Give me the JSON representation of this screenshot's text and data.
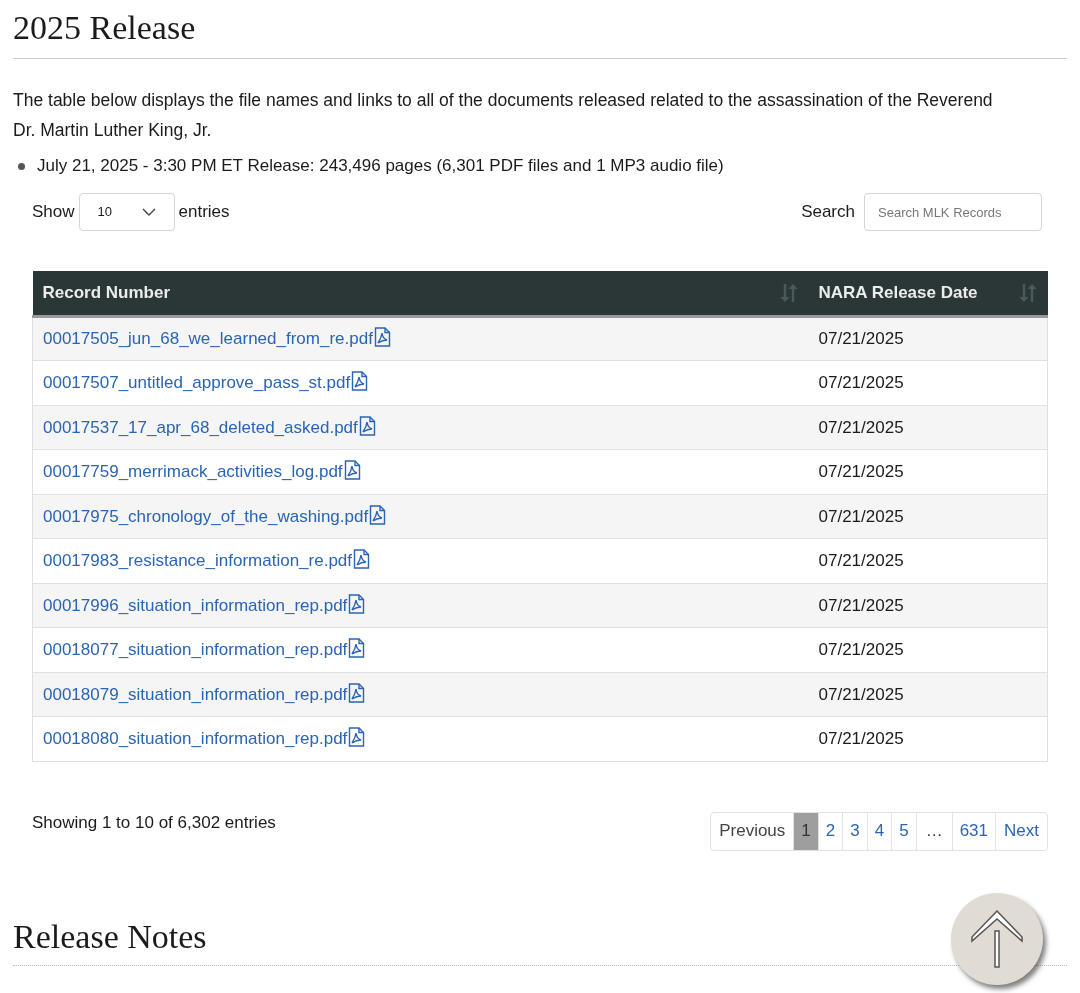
{
  "heading": "2025 Release",
  "intro": "The table below displays the file names and links to all of the documents released related to the assassination of the Reverend Dr. Martin Luther King, Jr.",
  "bullets": [
    "July 21, 2025 - 3:30 PM ET Release: 243,496 pages (6,301 PDF files and 1 MP3 audio file)"
  ],
  "length_control": {
    "before": "Show",
    "value": "10",
    "after": "entries"
  },
  "search": {
    "label": "Search",
    "placeholder": "Search MLK Records"
  },
  "table": {
    "columns": [
      "Record Number",
      "NARA Release Date"
    ],
    "rows": [
      {
        "file": "00017505_jun_68_we_learned_from_re.pdf",
        "date": "07/21/2025"
      },
      {
        "file": "00017507_untitled_approve_pass_st.pdf",
        "date": "07/21/2025"
      },
      {
        "file": "00017537_17_apr_68_deleted_asked.pdf",
        "date": "07/21/2025"
      },
      {
        "file": "00017759_merrimack_activities_log.pdf",
        "date": "07/21/2025"
      },
      {
        "file": "00017975_chronology_of_the_washing.pdf",
        "date": "07/21/2025"
      },
      {
        "file": "00017983_resistance_information_re.pdf",
        "date": "07/21/2025"
      },
      {
        "file": "00017996_situation_information_rep.pdf",
        "date": "07/21/2025"
      },
      {
        "file": "00018077_situation_information_rep.pdf",
        "date": "07/21/2025"
      },
      {
        "file": "00018079_situation_information_rep.pdf",
        "date": "07/21/2025"
      },
      {
        "file": "00018080_situation_information_rep.pdf",
        "date": "07/21/2025"
      }
    ]
  },
  "info": "Showing 1 to 10 of 6,302 entries",
  "pagination": [
    {
      "kind": "prev",
      "label": "Previous",
      "disabled": true
    },
    {
      "kind": "page",
      "label": "1",
      "selected": true
    },
    {
      "kind": "page",
      "label": "2",
      "selected": false
    },
    {
      "kind": "page",
      "label": "3",
      "selected": false
    },
    {
      "kind": "page",
      "label": "4",
      "selected": false
    },
    {
      "kind": "page",
      "label": "5",
      "selected": false
    },
    {
      "kind": "ellipsis",
      "label": "…"
    },
    {
      "kind": "page",
      "label": "631",
      "selected": false
    },
    {
      "kind": "next",
      "label": "Next",
      "disabled": false
    }
  ],
  "next_heading": "Release Notes"
}
